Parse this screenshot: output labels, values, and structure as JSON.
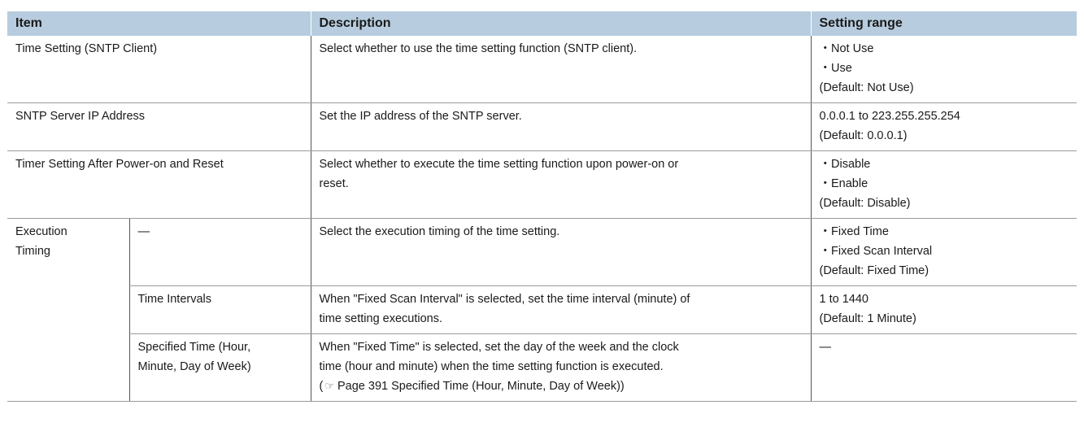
{
  "header": {
    "item": "Item",
    "description": "Description",
    "setting_range": "Setting range"
  },
  "rows": [
    {
      "item": "Time Setting (SNTP Client)",
      "description": "Select whether to use the time setting function (SNTP client).",
      "range": [
        "Not Use",
        "Use"
      ],
      "default": "(Default: Not Use)"
    },
    {
      "item": "SNTP Server IP Address",
      "description": "Set the IP address of the SNTP server.",
      "range_text": "0.0.0.1 to 223.255.255.254",
      "default": "(Default: 0.0.0.1)"
    },
    {
      "item": "Timer Setting After Power-on and Reset",
      "description_line1": "Select whether to execute the time setting function upon power-on or",
      "description_line2": "reset.",
      "range": [
        "Disable",
        "Enable"
      ],
      "default": "(Default: Disable)"
    },
    {
      "group": "Execution Timing",
      "group_line1": "Execution",
      "group_line2": "Timing",
      "subitem": "—",
      "description": "Select the execution timing of the time setting.",
      "range": [
        "Fixed Time",
        "Fixed Scan Interval"
      ],
      "default": "(Default: Fixed Time)"
    },
    {
      "subitem": "Time Intervals",
      "description_line1": "When \"Fixed Scan Interval\" is selected, set the time interval (minute) of",
      "description_line2": "time setting executions.",
      "range_text": "1 to 1440",
      "default": "(Default: 1 Minute)"
    },
    {
      "subitem_line1": "Specified Time (Hour,",
      "subitem_line2": "Minute, Day of Week)",
      "description_line1": "When \"Fixed Time\" is selected, set the day of the week and the clock",
      "description_line2": "time (hour and minute) when the time setting function is executed.",
      "ref_open": "(",
      "ref_icon": "☞",
      "ref_text": "Page 391 Specified Time (Hour, Minute, Day of Week))",
      "range_text": "—"
    }
  ]
}
